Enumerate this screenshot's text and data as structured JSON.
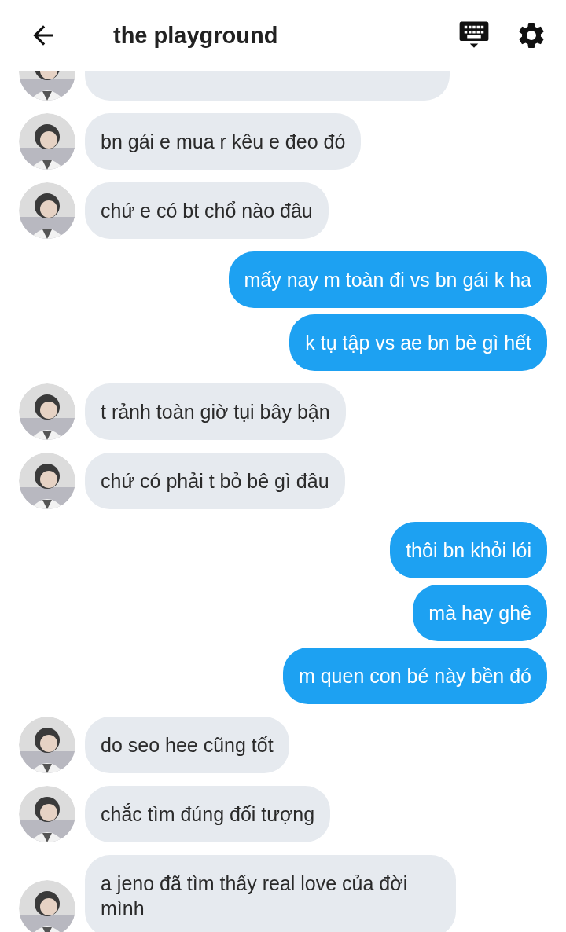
{
  "header": {
    "title": "the playground"
  },
  "messages": [
    {
      "kind": "cut"
    },
    {
      "kind": "in",
      "text": "bn gái e mua r kêu e đeo đó"
    },
    {
      "kind": "in",
      "text": "chứ e có bt chổ nào đâu"
    },
    {
      "kind": "out",
      "text": "mấy nay m toàn đi vs bn gái k ha"
    },
    {
      "kind": "out",
      "text": "k tụ tập vs ae bn bè gì hết"
    },
    {
      "kind": "in",
      "text": "t rảnh toàn giờ tụi bây bận"
    },
    {
      "kind": "in",
      "text": "chứ có phải t bỏ bê gì đâu"
    },
    {
      "kind": "out",
      "text": "thôi bn khỏi lói"
    },
    {
      "kind": "out",
      "text": "mà hay ghê"
    },
    {
      "kind": "out",
      "text": "m quen con bé này bền đó"
    },
    {
      "kind": "in",
      "text": "do seo hee cũng tốt"
    },
    {
      "kind": "in",
      "text": "chắc tìm đúng đối tượng"
    },
    {
      "kind": "in",
      "text": "a jeno đã tìm thấy real love của đời mình"
    }
  ]
}
